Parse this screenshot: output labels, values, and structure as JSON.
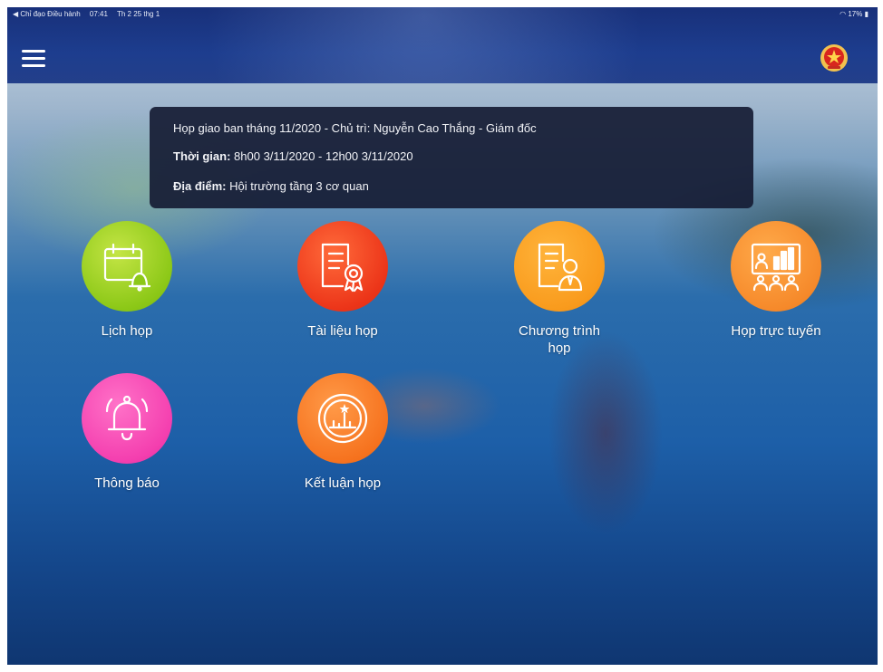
{
  "status_bar": {
    "back_app": "◀ Chỉ đạo Điều hành",
    "time": "07:41",
    "date": "Th 2 25 thg 1",
    "battery": "17%"
  },
  "meeting": {
    "title": "Họp giao ban tháng 11/2020 - Chủ trì: Nguyễn Cao Thắng - Giám đốc",
    "time_label": "Thời gian:",
    "time_value": "8h00 3/11/2020 - 12h00 3/11/2020",
    "place_label": "Địa điểm:",
    "place_value": "Hội trường tầng 3 cơ quan"
  },
  "menu": {
    "lich_hop": "Lịch họp",
    "tai_lieu_hop": "Tài liệu họp",
    "chuong_trinh_hop_1": "Chương trình",
    "chuong_trinh_hop_2": "họp",
    "hop_truc_tuyen": "Họp trực tuyến",
    "thong_bao": "Thông báo",
    "ket_luan_hop": "Kết luận họp"
  },
  "icons": {
    "menu": "hamburger-menu-icon",
    "emblem": "national-emblem-icon",
    "lich_hop": "calendar-bell-icon",
    "tai_lieu_hop": "document-award-icon",
    "chuong_trinh_hop": "document-person-icon",
    "hop_truc_tuyen": "presentation-people-icon",
    "thong_bao": "bell-icon",
    "ket_luan_hop": "chart-circle-icon"
  },
  "colors": {
    "header_bg": "#1d3d8e",
    "info_bg": "#161c34",
    "lich_hop": "#8cc817",
    "tai_lieu_hop": "#ec3519",
    "chuong_trinh_hop": "#f99b1d",
    "hop_truc_tuyen": "#f68a2b",
    "thong_bao": "#f43faf",
    "ket_luan_hop": "#f6731f"
  }
}
